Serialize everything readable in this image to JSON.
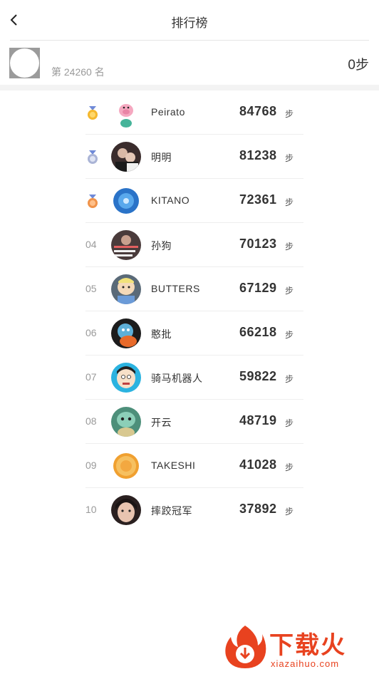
{
  "nav": {
    "title": "排行榜",
    "back_icon": "chevron-left-icon"
  },
  "me": {
    "rank_text": "第 24260 名",
    "steps_text": "0步"
  },
  "ranking": [
    {
      "rank": "01",
      "medal": "gold",
      "name": "Peirato",
      "steps": "84768",
      "unit": "步",
      "avatar": "pig-avatar"
    },
    {
      "rank": "02",
      "medal": "silver",
      "name": "明明",
      "steps": "81238",
      "unit": "步",
      "avatar": "couple-photo-avatar"
    },
    {
      "rank": "03",
      "medal": "bronze",
      "name": "KITANO",
      "steps": "72361",
      "unit": "步",
      "avatar": "blue-circle-avatar"
    },
    {
      "rank": "04",
      "medal": "",
      "name": "孙狗",
      "steps": "70123",
      "unit": "步",
      "avatar": "text-meme-avatar"
    },
    {
      "rank": "05",
      "medal": "",
      "name": "BUTTERS",
      "steps": "67129",
      "unit": "步",
      "avatar": "cartoon-butters-avatar"
    },
    {
      "rank": "06",
      "medal": "",
      "name": "憨批",
      "steps": "66218",
      "unit": "步",
      "avatar": "squirtle-avatar"
    },
    {
      "rank": "07",
      "medal": "",
      "name": "骑马机器人",
      "steps": "59822",
      "unit": "步",
      "avatar": "cartoon-boy-avatar"
    },
    {
      "rank": "08",
      "medal": "",
      "name": "开云",
      "steps": "48719",
      "unit": "步",
      "avatar": "squirtle-green-avatar"
    },
    {
      "rank": "09",
      "medal": "",
      "name": "TAKESHI",
      "steps": "41028",
      "unit": "步",
      "avatar": "orange-slice-avatar"
    },
    {
      "rank": "10",
      "medal": "",
      "name": "摔跤冠军",
      "steps": "37892",
      "unit": "步",
      "avatar": "girl-photo-avatar"
    }
  ],
  "watermark": {
    "brand": "下载火",
    "url": "xiazaihuo.com"
  },
  "colors": {
    "gold": "#f5b82e",
    "silver": "#aab4d6",
    "bronze": "#f0934a",
    "medal_ribbon": "#6f8ad8",
    "brand": "#e8421f"
  }
}
